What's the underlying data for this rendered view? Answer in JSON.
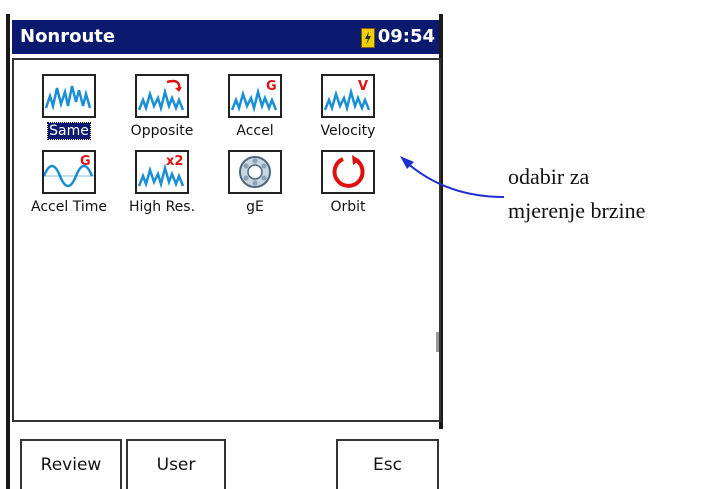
{
  "window": {
    "title": "Nonroute",
    "time": "09:54"
  },
  "icons": [
    {
      "label": "Same",
      "icon": "waveform-icon",
      "selected": true
    },
    {
      "label": "Opposite",
      "icon": "waveform-flip-icon",
      "selected": false
    },
    {
      "label": "Accel",
      "icon": "waveform-accel-icon",
      "badge": "G",
      "selected": false
    },
    {
      "label": "Velocity",
      "icon": "waveform-velocity-icon",
      "badge": "V",
      "selected": false
    },
    {
      "label": "Accel Time",
      "icon": "sine-accel-icon",
      "badge": "G",
      "selected": false
    },
    {
      "label": "High Res.",
      "icon": "waveform-highres-icon",
      "badge": "x2",
      "selected": false
    },
    {
      "label": "gE",
      "icon": "bearing-icon",
      "selected": false
    },
    {
      "label": "Orbit",
      "icon": "orbit-icon",
      "selected": false
    }
  ],
  "buttons": {
    "review": "Review",
    "user": "User",
    "esc": "Esc"
  },
  "annotation": {
    "line1": "odabir za",
    "line2": "mjerenje brzine"
  },
  "colors": {
    "titlebar": "#0b1a6e",
    "waveform": "#1a8fd6",
    "badge": "#e01010"
  }
}
